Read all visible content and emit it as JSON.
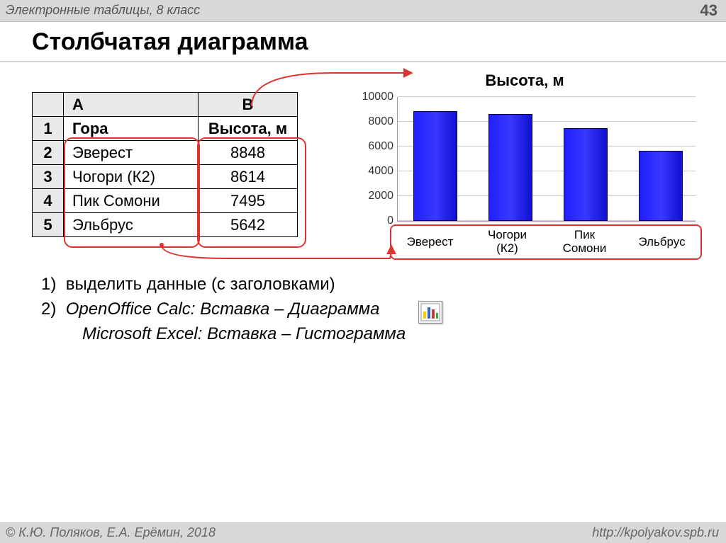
{
  "header": {
    "subject": "Электронные таблицы, 8 класс",
    "page_number": "43"
  },
  "title": "Столбчатая диаграмма",
  "spreadsheet": {
    "col_a": "A",
    "col_b": "B",
    "row1": "1",
    "row2": "2",
    "row3": "3",
    "row4": "4",
    "row5": "5",
    "a1": "Гора",
    "b1": "Высота, м",
    "a2": "Эверест",
    "b2": "8848",
    "a3": "Чогори (К2)",
    "b3": "8614",
    "a4": "Пик Сомони",
    "b4": "7495",
    "a5": "Эльбрус",
    "b5": "5642"
  },
  "chart_data": {
    "type": "bar",
    "title": "Высота, м",
    "categories": [
      "Эверест",
      "Чогори (К2)",
      "Пик Сомони",
      "Эльбрус"
    ],
    "values": [
      8848,
      8614,
      7495,
      5642
    ],
    "ylim": [
      0,
      10000
    ],
    "yticks": [
      0,
      2000,
      4000,
      6000,
      8000,
      10000
    ],
    "xlabel": "",
    "ylabel": ""
  },
  "yticks": {
    "t0": "0",
    "t1": "2000",
    "t2": "4000",
    "t3": "6000",
    "t4": "8000",
    "t5": "10000"
  },
  "xlabels": {
    "l0": "Эверест",
    "l1": "Чогори\n(К2)",
    "l2": "Пик\nСомони",
    "l3": "Эльбрус"
  },
  "steps": {
    "s1_num": "1)",
    "s1_text": "выделить данные (с заголовками)",
    "s2_num": "2)",
    "s2_oo": "OpenOffice Calc",
    "s2_oo_rest": ": Вставка – Диаграмма",
    "s2_ms": "Microsoft Excel",
    "s2_ms_rest": ": Вставка – Гистограмма"
  },
  "footer": {
    "author": "© К.Ю. Поляков, Е.А. Ерёмин, 2018",
    "url": "http://kpolyakov.spb.ru"
  }
}
